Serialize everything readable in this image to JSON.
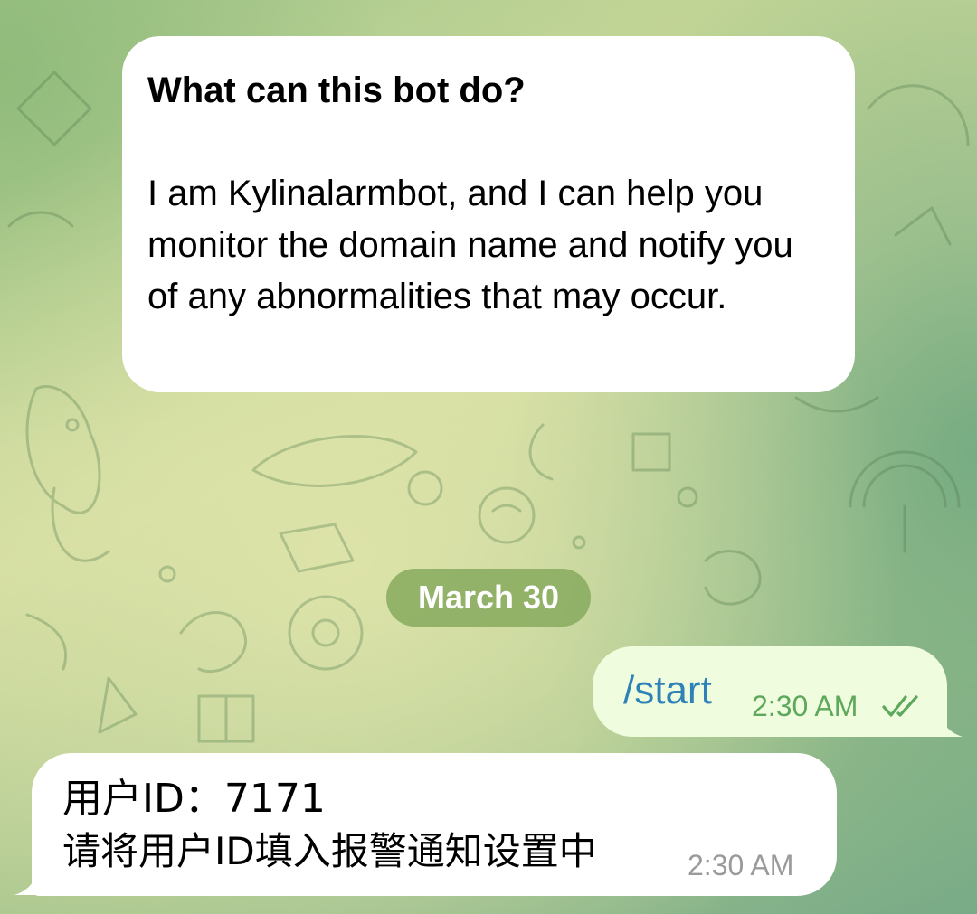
{
  "bot_intro": {
    "title": "What can this bot do?",
    "body": "I am Kylinalarmbot, and I can help you monitor the domain name and notify you of any abnormalities that may occur."
  },
  "date_separator": "March 30",
  "messages": [
    {
      "direction": "outgoing",
      "text": "/start",
      "time": "2:30 AM",
      "status": "read",
      "status_icon": "double-check-icon"
    },
    {
      "direction": "incoming",
      "line1": "用户ID：7171",
      "line2": "请将用户ID填入报警通知设置中",
      "time": "2:30 AM"
    }
  ],
  "colors": {
    "incoming_bubble": "#ffffff",
    "outgoing_bubble": "#effdde",
    "command_link": "#2f82b8",
    "outgoing_time": "#5ea85c",
    "incoming_time": "#9a9a9a",
    "date_pill": "#84a85c"
  }
}
